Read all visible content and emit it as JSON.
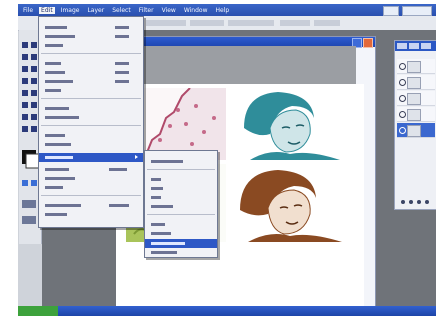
{
  "menubar": {
    "items": [
      "File",
      "Edit",
      "Image",
      "Layer",
      "Select",
      "Filter",
      "View",
      "Window",
      "Help"
    ],
    "active_index": 1
  },
  "colors": {
    "title_blue": "#2d5bd0",
    "highlight": "#2e58c6",
    "teal_tint": "#2f8d9a",
    "sepia_tint": "#8a4a22",
    "magenta_tint": "#b04a6a"
  },
  "icons": {
    "doc_close": "close-icon",
    "doc_minimize": "minimize-icon",
    "layer_visibility": "eye-icon"
  }
}
